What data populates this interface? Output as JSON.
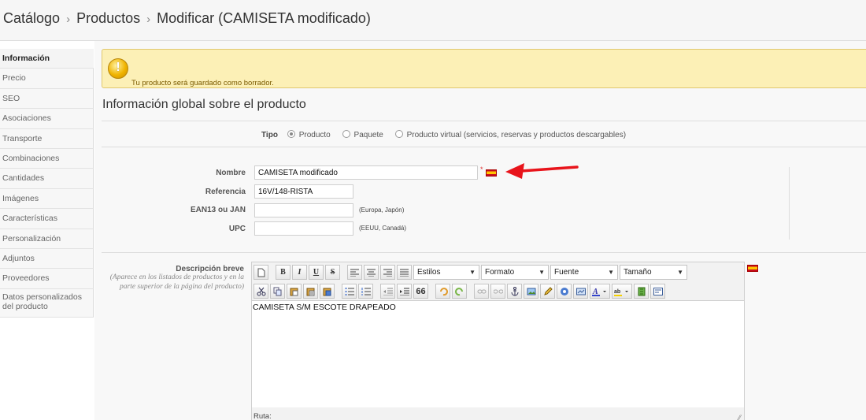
{
  "breadcrumb": {
    "items": [
      "Catálogo",
      "Productos",
      "Modificar (CAMISETA modificado)"
    ],
    "separator": "›"
  },
  "sidebar": {
    "items": [
      {
        "label": "Información",
        "active": true
      },
      {
        "label": "Precio"
      },
      {
        "label": "SEO"
      },
      {
        "label": "Asociaciones"
      },
      {
        "label": "Transporte"
      },
      {
        "label": "Combinaciones"
      },
      {
        "label": "Cantidades"
      },
      {
        "label": "Imágenes"
      },
      {
        "label": "Características"
      },
      {
        "label": "Personalización"
      },
      {
        "label": "Adjuntos"
      },
      {
        "label": "Proveedores"
      },
      {
        "label": "Datos personalizados del producto"
      }
    ]
  },
  "alert": {
    "icon": "warning-icon",
    "text": "Tu producto será guardado como borrador."
  },
  "section": {
    "title": "Información global sobre el producto"
  },
  "tipo": {
    "label": "Tipo",
    "options": [
      "Producto",
      "Paquete",
      "Producto virtual (servicios, reservas y productos descargables)"
    ],
    "selected": "Producto"
  },
  "fields": {
    "nombre": {
      "label": "Nombre",
      "value": "CAMISETA modificado",
      "required_mark": "*",
      "flag": "spain-flag-icon"
    },
    "referencia": {
      "label": "Referencia",
      "value": "16V/148-RISTA"
    },
    "ean13": {
      "label": "EAN13 ou JAN",
      "value": "",
      "note": "(Europa, Japón)"
    },
    "upc": {
      "label": "UPC",
      "value": "",
      "note": "(EEUU, Canadá)"
    }
  },
  "descripcion": {
    "label": "Descripción breve",
    "help": "(Aparece en los listados de productos y en la parte superior de la página del producto)",
    "content": "CAMISETA S/M ESCOTE DRAPEADO",
    "status_label": "Ruta:",
    "flag": "spain-flag-icon"
  },
  "editor_toolbar": {
    "row1_selects": [
      "Estilos",
      "Formato",
      "Fuente",
      "Tamaño"
    ],
    "bold": "B",
    "italic": "I",
    "underline": "U",
    "strike": "S",
    "quote": "66"
  },
  "colors": {
    "alert_bg": "#fcf0b6",
    "alert_border": "#e0c76e",
    "arrow": "#e8141b",
    "flag_red": "#c60b1e",
    "flag_yellow": "#ffc400"
  }
}
